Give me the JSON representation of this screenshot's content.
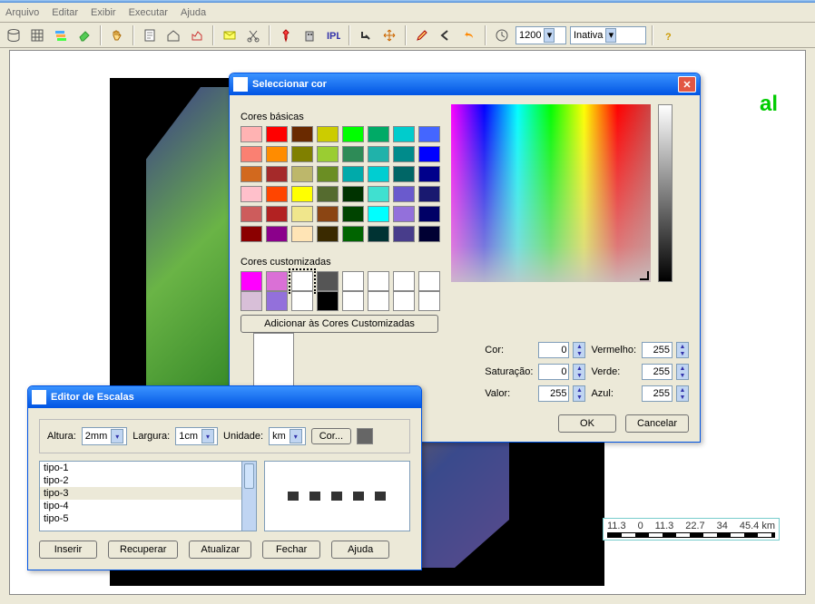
{
  "menu": {
    "arquivo": "Arquivo",
    "editar": "Editar",
    "exibir": "Exibir",
    "executar": "Executar",
    "ajuda": "Ajuda"
  },
  "toolbar": {
    "zoom": "1200",
    "status": "Inativa"
  },
  "canvas": {
    "al": "al"
  },
  "ruler": {
    "n0": "11.3",
    "n1": "0",
    "n2": "11.3",
    "n3": "22.7",
    "n4": "34",
    "n5": "45.4",
    "unit": "km"
  },
  "colorwin": {
    "title": "Seleccionar cor",
    "basic_lbl": "Cores básicas",
    "custom_lbl": "Cores customizadas",
    "add_custom": "Adicionar às Cores Customizadas",
    "ok": "OK",
    "cancel": "Cancelar",
    "hue_lbl": "Cor:",
    "sat_lbl": "Saturação:",
    "val_lbl": "Valor:",
    "r_lbl": "Vermelho:",
    "g_lbl": "Verde:",
    "b_lbl": "Azul:",
    "hue": "0",
    "sat": "0",
    "val": "255",
    "r": "255",
    "g": "255",
    "b": "255",
    "basic_colors": [
      "#ffb3b3",
      "#f00",
      "#6a2a00",
      "#cc0",
      "#0f0",
      "#0a6",
      "#0cc",
      "#46f",
      "#fa8072",
      "#ff8c00",
      "#808000",
      "#9acd32",
      "#2e8b57",
      "#20b2aa",
      "#008b8b",
      "#00f",
      "#d2691e",
      "#a52a2a",
      "#bdb76b",
      "#6b8e23",
      "#0aa",
      "#00ced1",
      "#006666",
      "#00008b",
      "#ffc0cb",
      "#ff4500",
      "#ff0",
      "#556b2f",
      "#003300",
      "#40e0d0",
      "#6a5acd",
      "#191970",
      "#cd5c5c",
      "#b22222",
      "#f0e68c",
      "#8b4513",
      "#004400",
      "#00ffff",
      "#9370db",
      "#000066",
      "#8b0000",
      "#8b008b",
      "#ffe4b5",
      "#3a2a00",
      "#006400",
      "#003333",
      "#483d8b",
      "#000033"
    ],
    "custom_colors": [
      "#f0f",
      "#da70d6",
      "#fff",
      "#555",
      "#fff",
      "#fff",
      "#fff",
      "#fff",
      "#d8bfd8",
      "#9370db",
      "#fff",
      "#000",
      "#fff",
      "#fff",
      "#fff",
      "#fff"
    ]
  },
  "scalewin": {
    "title": "Editor de Escalas",
    "altura_lbl": "Altura:",
    "altura": "2mm",
    "largura_lbl": "Largura:",
    "largura": "1cm",
    "unidade_lbl": "Unidade:",
    "unidade": "km",
    "cor_btn": "Cor...",
    "tipos": [
      "tipo-1",
      "tipo-2",
      "tipo-3",
      "tipo-4",
      "tipo-5"
    ],
    "inserir": "Inserir",
    "recuperar": "Recuperar",
    "atualizar": "Atualizar",
    "fechar": "Fechar",
    "ajuda": "Ajuda"
  }
}
